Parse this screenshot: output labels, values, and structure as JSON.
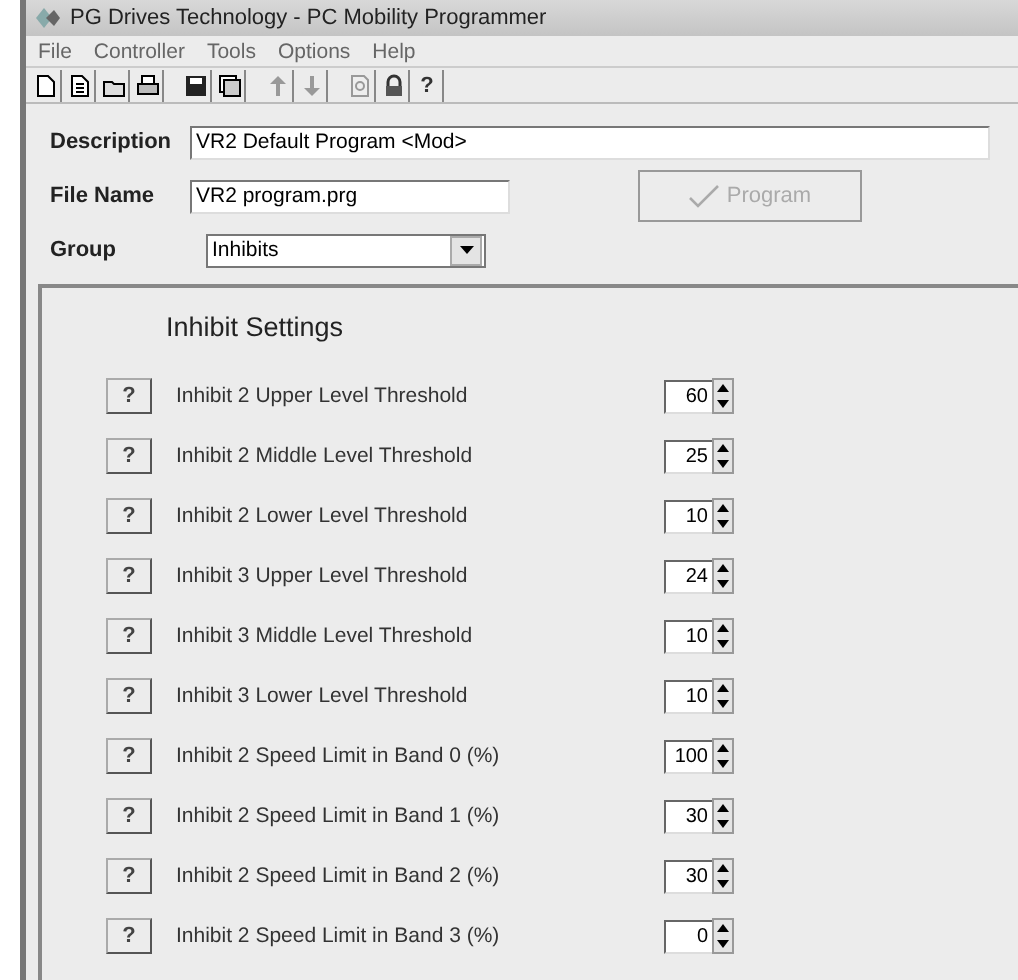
{
  "window": {
    "title": "PG Drives Technology - PC Mobility Programmer"
  },
  "menu": [
    "File",
    "Controller",
    "Tools",
    "Options",
    "Help"
  ],
  "toolbar": {
    "help_label": "?"
  },
  "description": {
    "label": "Description",
    "value": "VR2 Default Program <Mod>"
  },
  "file_name": {
    "label": "File Name",
    "value": "VR2 program.prg"
  },
  "program_button": {
    "label": "Program",
    "disabled": true
  },
  "group": {
    "label": "Group",
    "value": "Inhibits"
  },
  "panel": {
    "heading": "Inhibit Settings",
    "settings": [
      {
        "help": "?",
        "label": "Inhibit 2 Upper Level Threshold",
        "value": "60"
      },
      {
        "help": "?",
        "label": "Inhibit 2 Middle Level Threshold",
        "value": "25"
      },
      {
        "help": "?",
        "label": "Inhibit 2 Lower Level Threshold",
        "value": "10"
      },
      {
        "help": "?",
        "label": "Inhibit 3 Upper Level Threshold",
        "value": "24"
      },
      {
        "help": "?",
        "label": "Inhibit 3 Middle Level Threshold",
        "value": "10"
      },
      {
        "help": "?",
        "label": "Inhibit 3 Lower Level Threshold",
        "value": "10"
      },
      {
        "help": "?",
        "label": "Inhibit 2 Speed Limit in Band 0 (%)",
        "value": "100"
      },
      {
        "help": "?",
        "label": "Inhibit 2 Speed Limit in Band 1 (%)",
        "value": "30"
      },
      {
        "help": "?",
        "label": "Inhibit 2 Speed Limit in Band 2 (%)",
        "value": "30"
      },
      {
        "help": "?",
        "label": "Inhibit 2 Speed Limit in Band 3 (%)",
        "value": "0"
      }
    ]
  }
}
